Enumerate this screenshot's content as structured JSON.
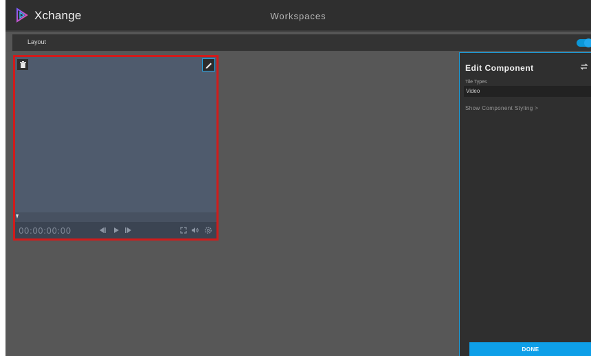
{
  "header": {
    "brand": "Xchange",
    "title": "Workspaces"
  },
  "layout_bar": {
    "label": "Layout",
    "toggle_on": true
  },
  "tile": {
    "timecode": "00:00:00:00",
    "progress": 0
  },
  "panel": {
    "title": "Edit Component",
    "tile_types_label": "Tile Types",
    "tile_types_value": "Video",
    "styling_link": "Show Component Styling >",
    "done_label": "DONE"
  },
  "colors": {
    "accent": "#0e9fe8",
    "selection_border": "#d11b1b",
    "topbar": "#2f2f2f",
    "canvas": "#575757",
    "panel": "#2f2f2f"
  },
  "icons": [
    "xchange-logo-icon",
    "trash-icon",
    "pencil-icon",
    "step-back-icon",
    "play-icon",
    "step-forward-icon",
    "fullscreen-icon",
    "volume-icon",
    "settings-icon",
    "swap-icon"
  ]
}
